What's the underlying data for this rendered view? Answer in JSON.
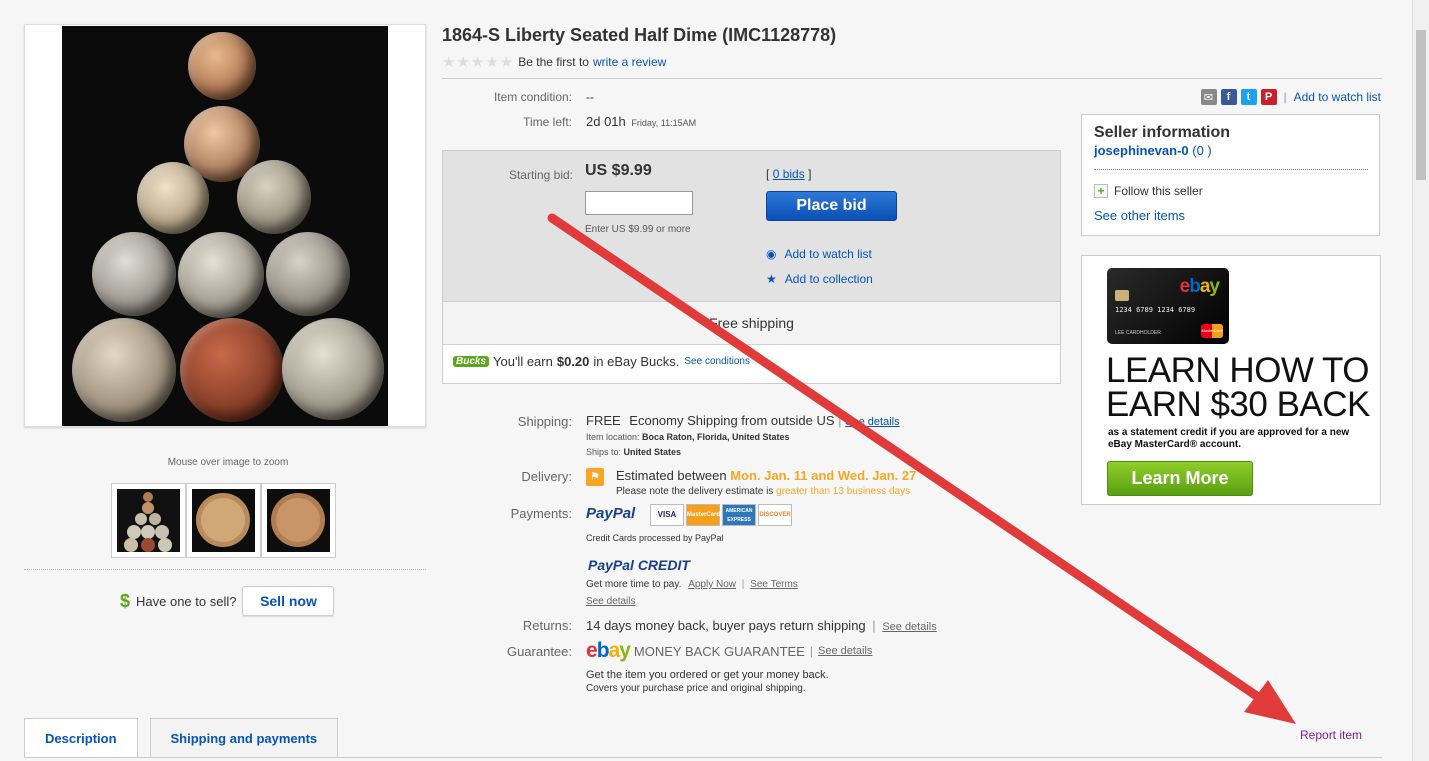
{
  "item": {
    "title": "1864-S Liberty Seated Half Dime (IMC1128778)",
    "rating_stars": "★★★★★",
    "be_first": "Be the first to",
    "write_review": "write a review"
  },
  "gallery": {
    "zoom_hint": "Mouse over image to zoom"
  },
  "sell": {
    "dollar": "$",
    "text": "Have one to sell?",
    "button": "Sell now"
  },
  "details": {
    "condition_label": "Item condition:",
    "condition_value": "--",
    "time_label": "Time left:",
    "time_value": "2d 01h",
    "time_detail": "Friday, 11:15AM"
  },
  "share": {
    "email_icon": "✉",
    "fb_icon": "f",
    "tw_icon": "t",
    "pin_icon": "P",
    "sep": "|",
    "watch": "Add to watch list"
  },
  "bid": {
    "label": "Starting bid:",
    "price": "US $9.99",
    "bids": "0 bids",
    "bids_open": "[",
    "bids_close": "]",
    "hint": "Enter US $9.99 or more",
    "button": "Place bid",
    "watch": "Add to watch list",
    "collection": "Add to collection",
    "free_shipping": "Free shipping",
    "bucks_tag": "Bucks",
    "bucks_pre": "You'll earn",
    "bucks_amount": "$0.20",
    "bucks_post": "in eBay Bucks.",
    "see_conditions": "See conditions"
  },
  "shipping": {
    "label": "Shipping:",
    "free": "FREE",
    "method": "Economy Shipping from outside US",
    "sep": "|",
    "see_details": "See details",
    "location_label": "Item location:",
    "location": "Boca Raton, Florida, United States",
    "ships_label": "Ships to:",
    "ships_to": "United States"
  },
  "delivery": {
    "label": "Delivery:",
    "estimated": "Estimated between",
    "dates": "Mon. Jan. 11 and Wed. Jan. 27",
    "note": "Please note the delivery estimate is",
    "note_highlight": "greater than 13 business days"
  },
  "payments": {
    "label": "Payments:",
    "paypal": "PayPal",
    "cards": [
      "VISA",
      "MasterCard",
      "AMERICAN EXPRESS",
      "DISCOVER"
    ],
    "processed": "Credit Cards processed by PayPal",
    "paypal_credit": "PayPal CREDIT",
    "more_time": "Get more time to pay.",
    "apply_now": "Apply Now",
    "sep": "|",
    "see_terms": "See Terms",
    "see_details": "See details"
  },
  "returns": {
    "label": "Returns:",
    "text": "14 days money back, buyer pays return shipping",
    "sep": "|",
    "see_details": "See details"
  },
  "guarantee": {
    "label": "Guarantee:",
    "logo": "ebay",
    "text": "MONEY BACK GUARANTEE",
    "sep": "|",
    "see_details": "See details",
    "line1": "Get the item you ordered or get your money back.",
    "line2": "Covers your purchase price and original shipping."
  },
  "seller": {
    "heading": "Seller information",
    "name": "josephinevan-0",
    "feedback": "(0 )",
    "follow": "Follow this seller",
    "other": "See other items"
  },
  "ad": {
    "card_logo": "ebay",
    "card_number": "1234 6789 1234 6789",
    "card_name": "LEE CARDHOLDER",
    "card_brand": "MasterCard",
    "headline_1": "LEARN HOW TO",
    "headline_2": "EARN $30 BACK",
    "sub": "as a statement credit if you are approved for a new eBay MasterCard® account.",
    "button": "Learn More"
  },
  "tabs": [
    "Description",
    "Shipping and payments"
  ],
  "report": "Report item",
  "colors": {
    "link": "#0654ba",
    "accent_orange": "#f5a623",
    "bucks_green": "#5ba71b",
    "arrow_red": "#e03a3a",
    "report_purple": "#7b1c9e"
  }
}
